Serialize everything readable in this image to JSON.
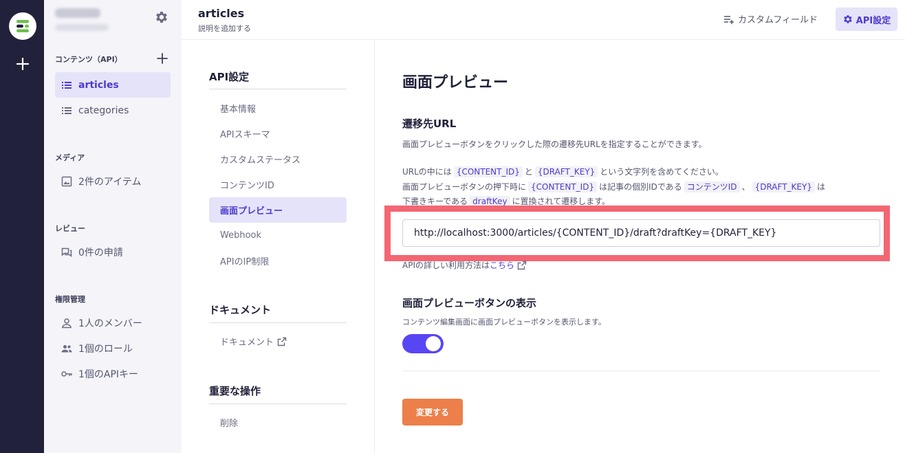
{
  "colors": {
    "accent": "#4c3bcf",
    "toggle": "#5846f5",
    "save": "#ed7f4a",
    "highlight": "#f36672",
    "rail": "#21213b"
  },
  "sidebar": {
    "content_section": "コンテンツ（API）",
    "content_items": [
      {
        "label": "articles",
        "icon": "list-icon",
        "active": true
      },
      {
        "label": "categories",
        "icon": "list-icon",
        "active": false
      }
    ],
    "media_section": "メディア",
    "media_item": "2件のアイテム",
    "review_section": "レビュー",
    "review_item": "0件の申請",
    "perm_section": "権限管理",
    "perm_items": [
      {
        "label": "1人のメンバー",
        "icon": "person-icon"
      },
      {
        "label": "1個のロール",
        "icon": "group-icon"
      },
      {
        "label": "1個のAPIキー",
        "icon": "key-icon"
      }
    ]
  },
  "header": {
    "title": "articles",
    "subtitle": "説明を追加する",
    "custom_field": "カスタムフィールド",
    "api_settings": "API設定"
  },
  "menu": {
    "section1": "API設定",
    "items": [
      "基本情報",
      "APIスキーマ",
      "カスタムステータス",
      "コンテンツID",
      "画面プレビュー",
      "Webhook",
      "APIのIP制限"
    ],
    "active_index": 4,
    "section2": "ドキュメント",
    "doc_item": "ドキュメント",
    "section3": "重要な操作",
    "delete_item": "削除"
  },
  "main": {
    "page_title": "画面プレビュー",
    "url_title": "遷移先URL",
    "url_desc": "画面プレビューボタンをクリックした際の遷移先URLを指定することができます。",
    "note": {
      "l1_a": "URLの中には",
      "code_content_id": "{CONTENT_ID}",
      "l1_b": "と",
      "code_draft_key": "{DRAFT_KEY}",
      "l1_c": "という文字列を含めてください。",
      "l2_a": "画面プレビューボタンの押下時に",
      "l2_b": "は記事の個別IDである",
      "code_contents_id": "コンテンツID",
      "l2_c": "、",
      "l2_d": "は",
      "l3_a": "下書きキーである",
      "code_draftkey": "draftKey",
      "l3_b": "に置換されて遷移します。"
    },
    "url_value": "http://localhost:3000/articles/{CONTENT_ID}/draft?draftKey={DRAFT_KEY}",
    "api_usage": "APIの詳しい利用方法は",
    "api_usage_link": "こちら",
    "toggle_title": "画面プレビューボタンの表示",
    "toggle_desc": "コンテンツ編集画面に画面プレビューボタンを表示します。",
    "toggle_on": true,
    "save_label": "変更する"
  }
}
